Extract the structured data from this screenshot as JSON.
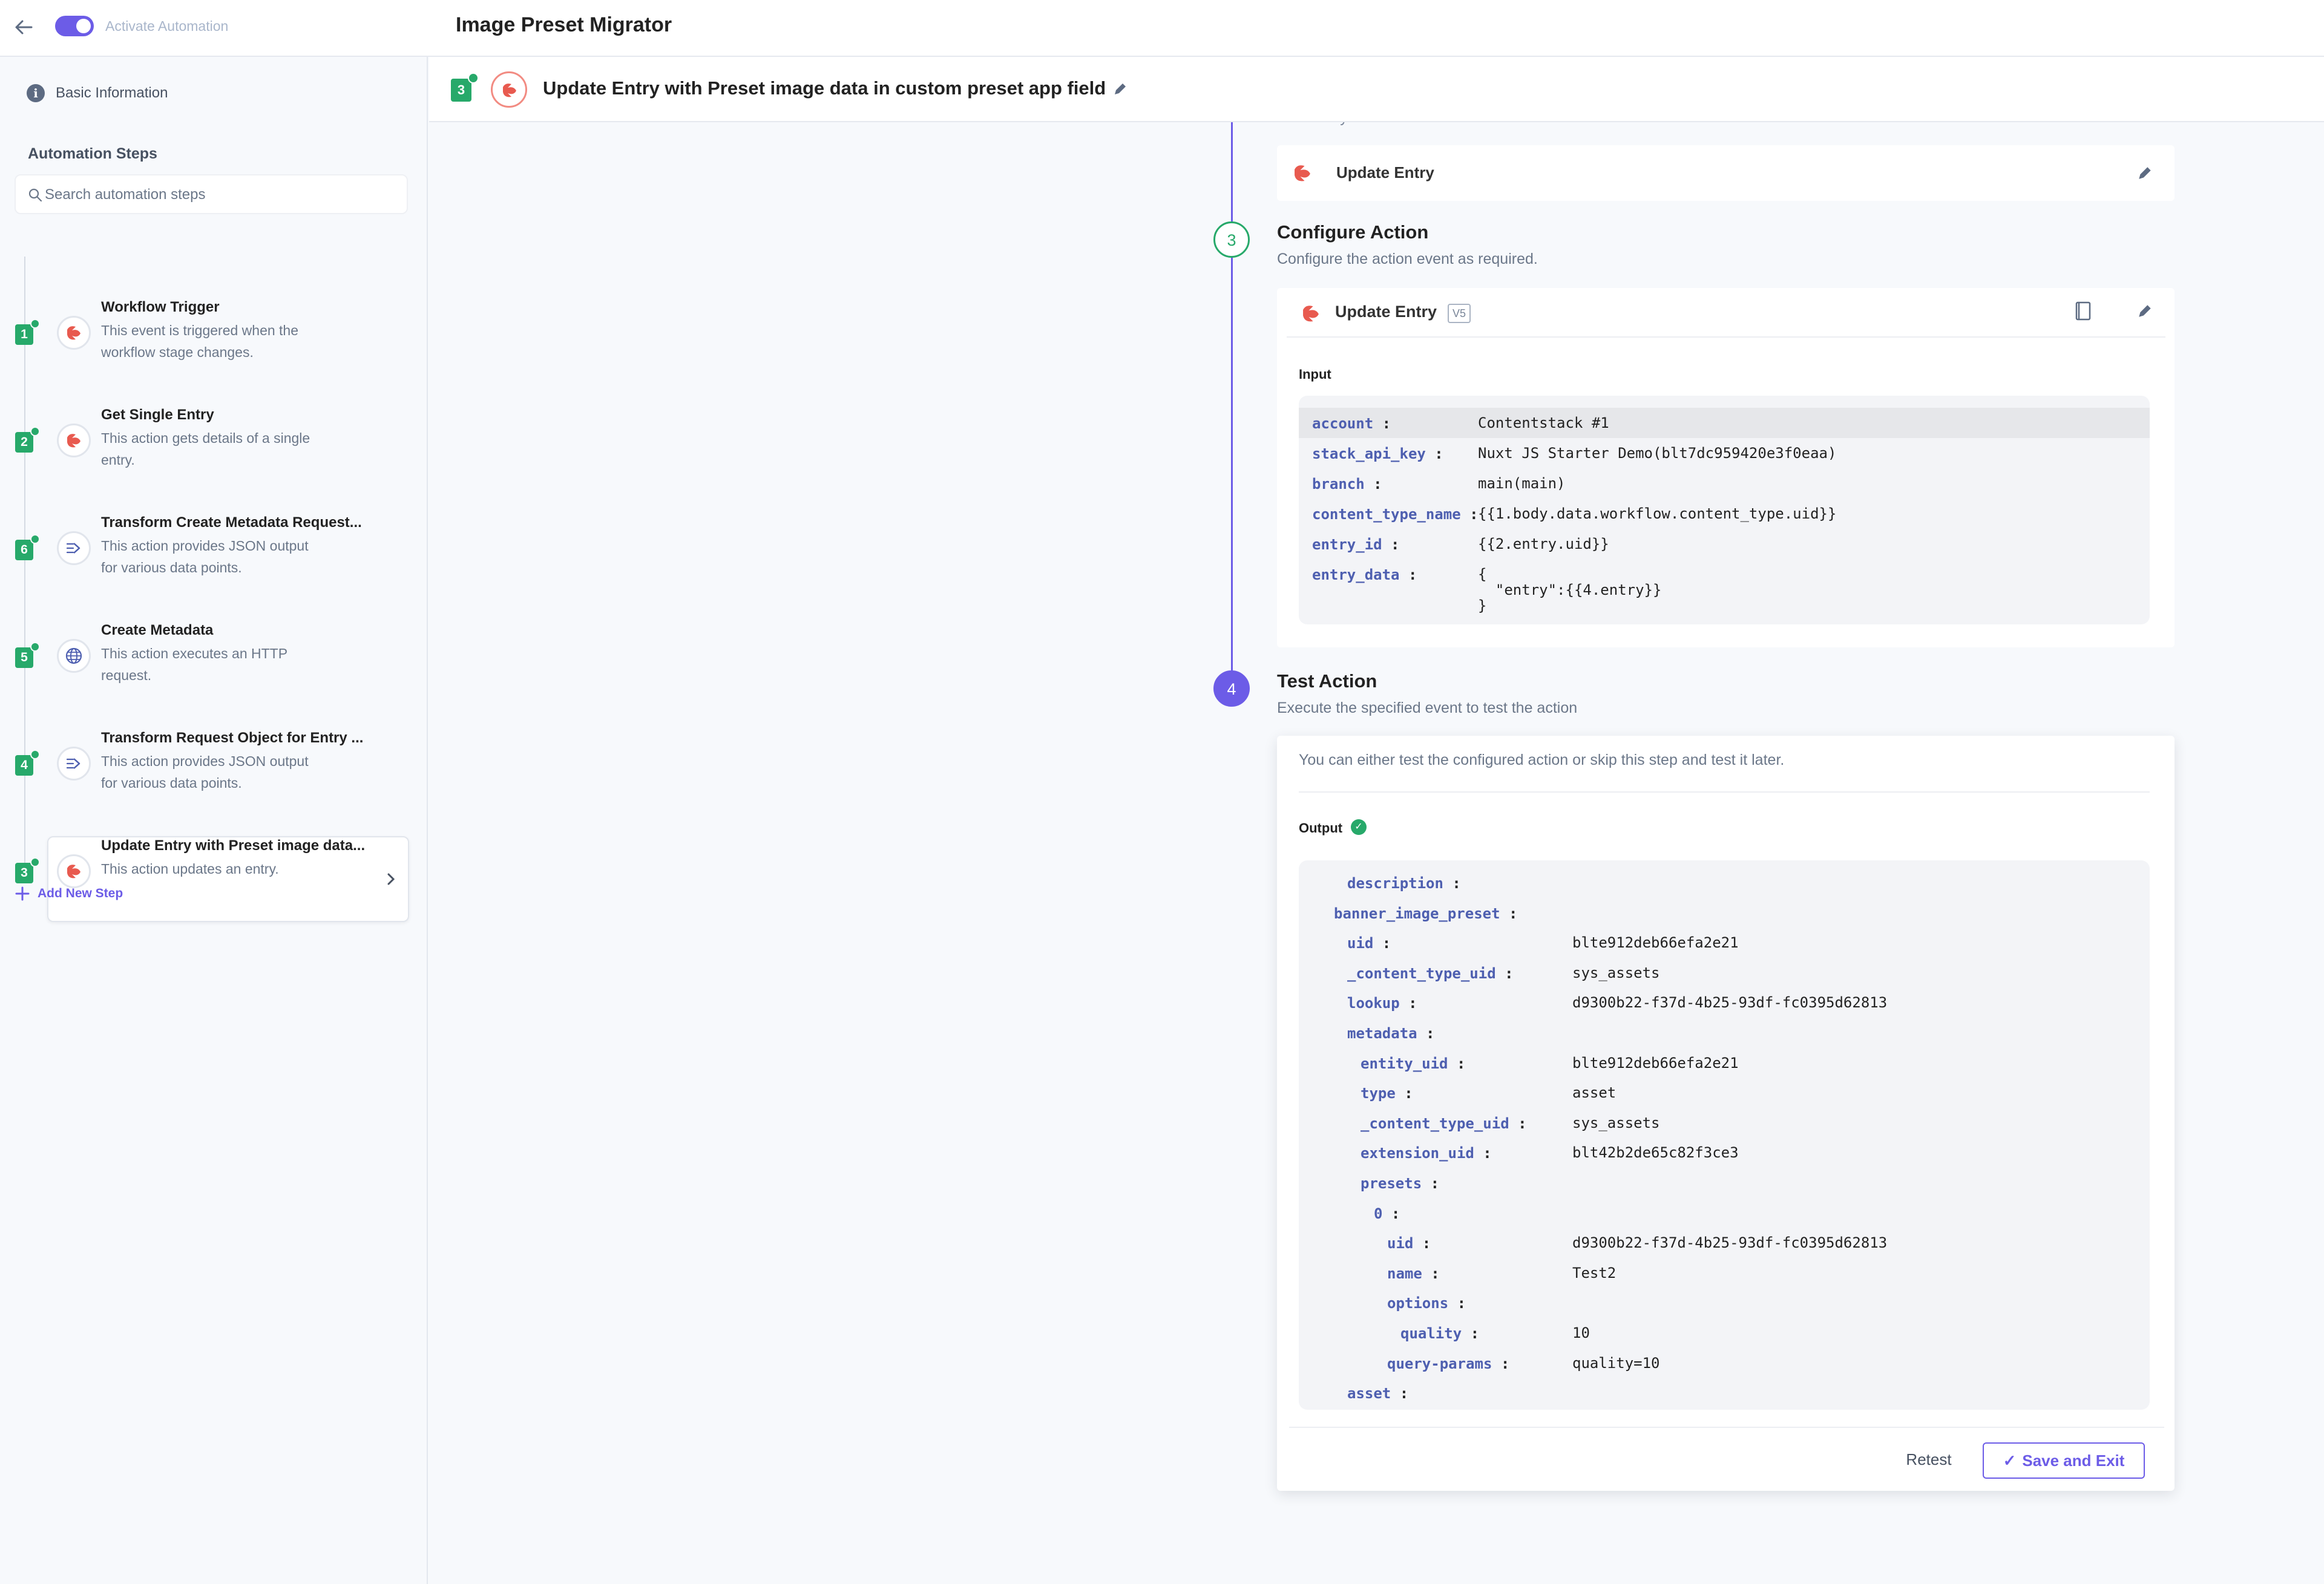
{
  "topbar": {
    "toggle_label": "Activate Automation",
    "title": "Image Preset Migrator",
    "accent_color": "#6c5ce7"
  },
  "sidebar": {
    "basic_info": "Basic Information",
    "steps_heading": "Automation Steps",
    "search_placeholder": "Search automation steps",
    "steps": [
      {
        "badge": "1",
        "title": "Workflow Trigger",
        "desc": "This event is triggered when the workflow stage changes.",
        "icon": "contentstack-icon"
      },
      {
        "badge": "2",
        "title": "Get Single Entry",
        "desc": "This action gets details of a single entry.",
        "icon": "contentstack-icon"
      },
      {
        "badge": "6",
        "title": "Transform Create Metadata Request...",
        "desc": "This action provides JSON output for various data points.",
        "icon": "transform-icon"
      },
      {
        "badge": "5",
        "title": "Create Metadata",
        "desc": "This action executes an HTTP request.",
        "icon": "globe-icon"
      },
      {
        "badge": "4",
        "title": "Transform Request Object for Entry ...",
        "desc": "This action provides JSON output for various data points.",
        "icon": "transform-icon"
      },
      {
        "badge": "3",
        "title": "Update Entry with Preset image data...",
        "desc": "This action updates an entry.",
        "icon": "contentstack-icon",
        "active": true
      }
    ],
    "add_step": "Add New Step"
  },
  "header": {
    "badge": "3",
    "title": "Update Entry with Preset image data in custom preset app field"
  },
  "main": {
    "cut_text": "Select any one of the action events.",
    "event_label": "Update Entry",
    "configure": {
      "step_number": "3",
      "title": "Configure Action",
      "subtitle": "Configure the action event as required.",
      "card_title": "Update Entry",
      "version": "V5",
      "input_label": "Input",
      "rows": [
        {
          "key": "account",
          "value": "Contentstack #1"
        },
        {
          "key": "stack_api_key",
          "value": "Nuxt JS Starter Demo(blt7dc959420e3f0eaa)"
        },
        {
          "key": "branch",
          "value": "main(main)"
        },
        {
          "key": "content_type_name",
          "value": "{{1.body.data.workflow.content_type.uid}}"
        },
        {
          "key": "entry_id",
          "value": "{{2.entry.uid}}"
        },
        {
          "key": "entry_data",
          "value": "{\n  \"entry\":{{4.entry}}\n}"
        }
      ]
    },
    "test": {
      "step_number": "4",
      "title": "Test Action",
      "subtitle": "Execute the specified event to test the action",
      "note": "You can either test the configured action or skip this step and test it later.",
      "output_label": "Output",
      "rows": [
        {
          "key": "description",
          "value": "",
          "depth": 1
        },
        {
          "key": "banner_image_preset",
          "value": "",
          "depth": 0
        },
        {
          "key": "uid",
          "value": "blte912deb66efa2e21",
          "depth": 1
        },
        {
          "key": "_content_type_uid",
          "value": "sys_assets",
          "depth": 1
        },
        {
          "key": "lookup",
          "value": "d9300b22-f37d-4b25-93df-fc0395d62813",
          "depth": 1
        },
        {
          "key": "metadata",
          "value": "",
          "depth": 1
        },
        {
          "key": "entity_uid",
          "value": "blte912deb66efa2e21",
          "depth": 2
        },
        {
          "key": "type",
          "value": "asset",
          "depth": 2
        },
        {
          "key": "_content_type_uid",
          "value": "sys_assets",
          "depth": 2
        },
        {
          "key": "extension_uid",
          "value": "blt42b2de65c82f3ce3",
          "depth": 2
        },
        {
          "key": "presets",
          "value": "",
          "depth": 2
        },
        {
          "key": "0",
          "value": "",
          "depth": 3
        },
        {
          "key": "uid",
          "value": "d9300b22-f37d-4b25-93df-fc0395d62813",
          "depth": 4
        },
        {
          "key": "name",
          "value": "Test2",
          "depth": 4
        },
        {
          "key": "options",
          "value": "",
          "depth": 4
        },
        {
          "key": "quality",
          "value": "10",
          "depth": 5
        },
        {
          "key": "query-params",
          "value": "quality=10",
          "depth": 4
        },
        {
          "key": "asset",
          "value": "",
          "depth": 1
        }
      ],
      "retest_label": "Retest",
      "save_label": "Save and Exit"
    }
  }
}
